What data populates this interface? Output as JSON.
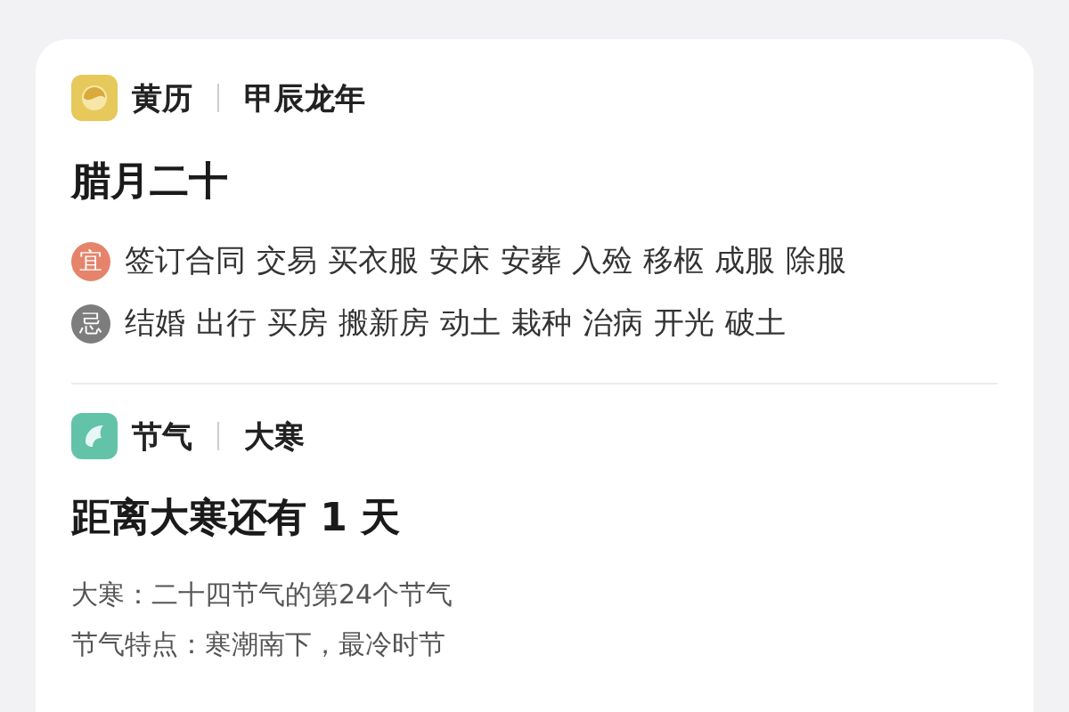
{
  "almanac": {
    "app_name": "黄历",
    "year_label": "甲辰龙年",
    "lunar_date": "腊月二十",
    "rows": [
      {
        "kind": "good",
        "badge": "宜",
        "items": [
          "签订合同",
          "交易",
          "买衣服",
          "安床",
          "安葬",
          "入殓",
          "移柩",
          "成服",
          "除服"
        ]
      },
      {
        "kind": "bad",
        "badge": "忌",
        "items": [
          "结婚",
          "出行",
          "买房",
          "搬新房",
          "动土",
          "栽种",
          "治病",
          "开光",
          "破土"
        ]
      }
    ]
  },
  "solar_term": {
    "app_name": "节气",
    "term_label": "大寒",
    "countdown": "距离大寒还有 1 天",
    "details": [
      "大寒：二十四节气的第24个节气",
      "节气特点：寒潮南下，最冷时节"
    ]
  }
}
